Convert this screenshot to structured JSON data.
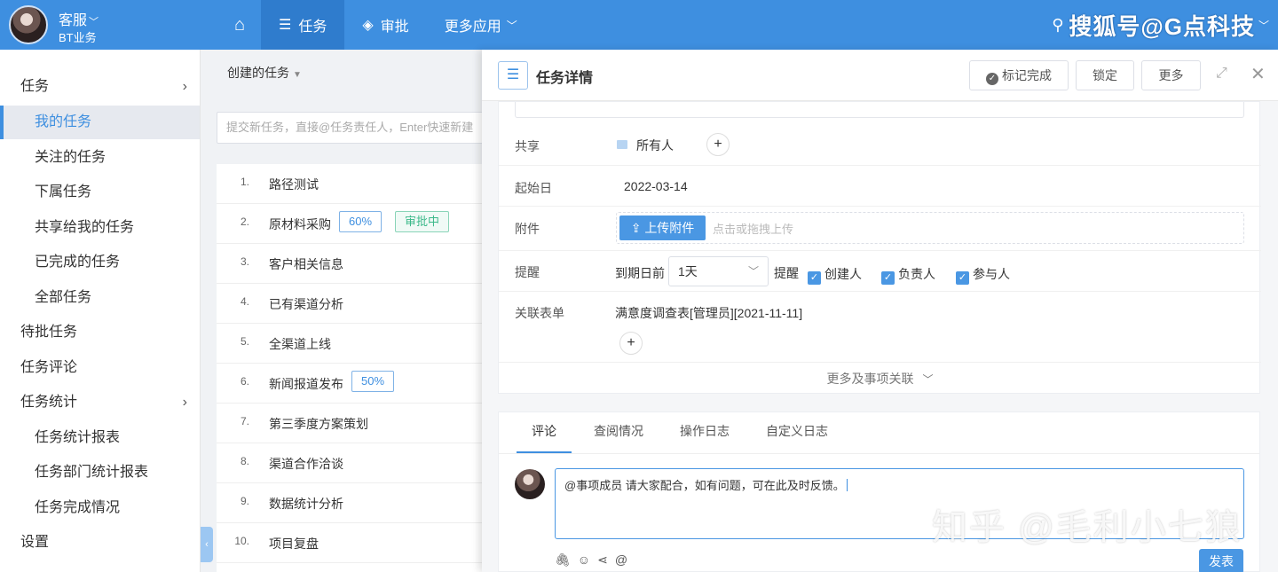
{
  "header": {
    "user_name": "客服",
    "org": "BT业务",
    "nav": [
      {
        "label": "任务",
        "icon": "list-icon"
      },
      {
        "label": "审批",
        "icon": "layers-icon"
      },
      {
        "label": "更多应用",
        "icon": "chevron-down-icon"
      }
    ],
    "watermark": "搜狐号@G点科技"
  },
  "sidebar": {
    "items": [
      {
        "label": "任务"
      },
      {
        "label": "我的任务"
      },
      {
        "label": "关注的任务"
      },
      {
        "label": "下属任务"
      },
      {
        "label": "共享给我的任务"
      },
      {
        "label": "已完成的任务"
      },
      {
        "label": "全部任务"
      },
      {
        "label": "待批任务"
      },
      {
        "label": "任务评论"
      },
      {
        "label": "任务统计"
      },
      {
        "label": "任务统计报表"
      },
      {
        "label": "任务部门统计报表"
      },
      {
        "label": "任务完成情况"
      },
      {
        "label": "设置"
      }
    ]
  },
  "list": {
    "filter_label": "创建的任务",
    "new_task_placeholder": "提交新任务，直接@任务责任人，Enter快速新建",
    "tasks": [
      {
        "num": "1.",
        "title": "路径测试"
      },
      {
        "num": "2.",
        "title": "原材料采购",
        "progress": "60%",
        "status": "审批中"
      },
      {
        "num": "3.",
        "title": "客户相关信息"
      },
      {
        "num": "4.",
        "title": "已有渠道分析"
      },
      {
        "num": "5.",
        "title": "全渠道上线"
      },
      {
        "num": "6.",
        "title": "新闻报道发布",
        "progress": "50%"
      },
      {
        "num": "7.",
        "title": "第三季度方案策划"
      },
      {
        "num": "8.",
        "title": "渠道合作洽谈"
      },
      {
        "num": "9.",
        "title": "数据统计分析"
      },
      {
        "num": "10.",
        "title": "项目复盘"
      }
    ]
  },
  "detail": {
    "title": "任务详情",
    "buttons": {
      "mark_done": "标记完成",
      "lock": "锁定",
      "more": "更多"
    },
    "share": {
      "label": "共享",
      "value": "所有人"
    },
    "start": {
      "label": "起始日",
      "value": "2022-03-14"
    },
    "attachment": {
      "label": "附件",
      "button": "上传附件",
      "hint": "点击或拖拽上传"
    },
    "reminder": {
      "label": "提醒",
      "prefix": "到期日前",
      "select_value": "1天",
      "suffix": "提醒",
      "options": [
        "创建人",
        "负责人",
        "参与人"
      ]
    },
    "related_form": {
      "label": "关联表单",
      "value": "满意度调查表[管理员][2021-11-11]"
    },
    "more_relations": "更多及事项关联",
    "tabs": [
      "评论",
      "查阅情况",
      "操作日志",
      "自定义日志"
    ],
    "comment_text": "@事项成员 请大家配合，如有问题，可在此及时反馈。",
    "send_label": "发表"
  },
  "watermark_bottom": "知乎 @毛利小七狼"
}
